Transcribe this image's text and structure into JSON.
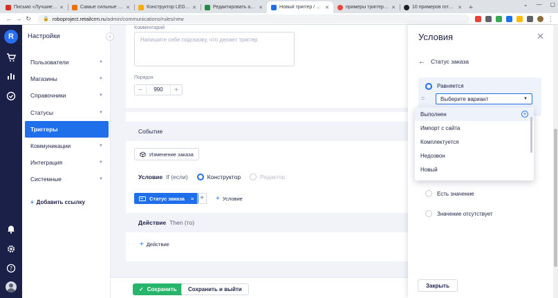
{
  "browser": {
    "tabs": [
      {
        "title": "Письмо «Лучшие мате",
        "color": "#d93025",
        "active": false
      },
      {
        "title": "Самые сильные идеи",
        "color": "#e8710a",
        "active": false
      },
      {
        "title": "Конструктор LEGO Edu",
        "color": "#f9ab00",
        "active": false
      },
      {
        "title": "Редактировать автора",
        "color": "#1e8e3e",
        "active": false
      },
      {
        "title": "Новый триггер / Триг",
        "color": "#1f6feb",
        "active": true
      },
      {
        "title": "примеры триггеров по",
        "color": "#e8453c",
        "active": false
      },
      {
        "title": "10 примеров готовых",
        "color": "#202124",
        "active": false
      }
    ],
    "url_host": "roboproject.retailcrm.ru",
    "url_path": "/admin/communications/rules/new"
  },
  "sidebar": {
    "title": "Настройки",
    "items": [
      {
        "label": "Пользователи",
        "active": false
      },
      {
        "label": "Магазины",
        "active": false
      },
      {
        "label": "Справочники",
        "active": false
      },
      {
        "label": "Статусы",
        "active": false
      },
      {
        "label": "Триггеры",
        "active": true
      },
      {
        "label": "Коммуникации",
        "active": false
      },
      {
        "label": "Интеграция",
        "active": false
      },
      {
        "label": "Системные",
        "active": false
      }
    ],
    "add_link": "Добавить ссылку"
  },
  "form": {
    "comment_label": "Комментарий",
    "comment_placeholder": "Напишите себе подсказку, что делает триггер",
    "order_label": "Порядок",
    "order_value": "990",
    "event_header": "Событие",
    "event_chip": "Изменение заказа",
    "condition_label": "Условие",
    "condition_sub": "If (если)",
    "mode_constructor": "Конструктор",
    "mode_editor": "Редактор",
    "condition_chip": "Статус заказа",
    "condition_op": "=",
    "add_condition": "Условие",
    "action_header": "Действие",
    "action_sub": "Then (то)",
    "add_action": "Действие",
    "save": "Сохранить",
    "save_exit": "Сохранить и выйти"
  },
  "drawer": {
    "title": "Условия",
    "back_label": "Статус заказа",
    "option_equals": "Равняется",
    "select_placeholder": "Выберите вариант",
    "option_has_value": "Есть значение",
    "option_no_value": "Значение отсутствует",
    "close": "Закрыть"
  },
  "dropdown": {
    "items": [
      "Выполнен",
      "Импорт с сайта",
      "Комплектуется",
      "Недозвон",
      "Новый"
    ]
  },
  "colors": {
    "accent": "#1f6feb",
    "rail": "#1a2048",
    "success": "#27b56b"
  }
}
